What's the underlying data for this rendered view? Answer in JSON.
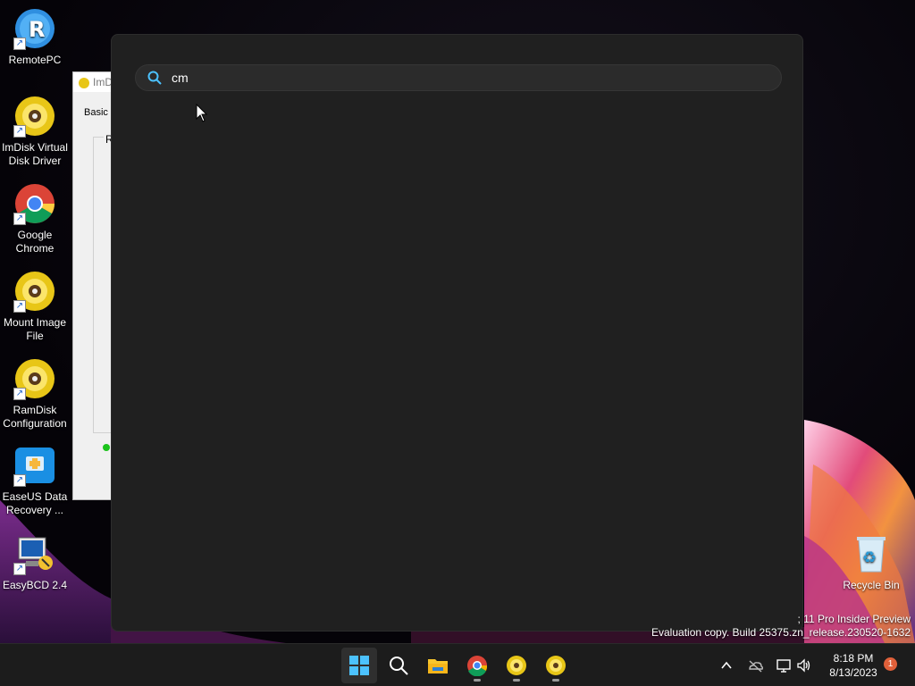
{
  "desktop": {
    "icons": [
      {
        "label": "RemotePC"
      },
      {
        "label": "ImDisk Virtual Disk Driver"
      },
      {
        "label": "Google Chrome"
      },
      {
        "label": "Mount Image File"
      },
      {
        "label": "RamDisk Configuration"
      },
      {
        "label": "EaseUS Data Recovery ..."
      },
      {
        "label": "EasyBCD 2.4"
      },
      {
        "label": "Recycle Bin"
      }
    ]
  },
  "background_window": {
    "title": "ImD",
    "tab": "Basic",
    "group_label": "Ra"
  },
  "search": {
    "query": "cm"
  },
  "watermark": {
    "line1": "; 11 Pro Insider Preview",
    "line2": "Evaluation copy. Build 25375.zn_release.230520-1632"
  },
  "taskbar": {
    "apps": [
      "start-icon",
      "search-icon",
      "file-explorer-icon",
      "chrome-icon",
      "disk-icon",
      "disk-icon"
    ],
    "time": "8:18 PM",
    "date": "8/13/2023",
    "notification_count": "1"
  },
  "colors": {
    "flyout_bg": "#202020",
    "search_bg": "#2b2b2b",
    "taskbar_bg": "#1c1c1c",
    "accent": "#4cc2ff"
  }
}
